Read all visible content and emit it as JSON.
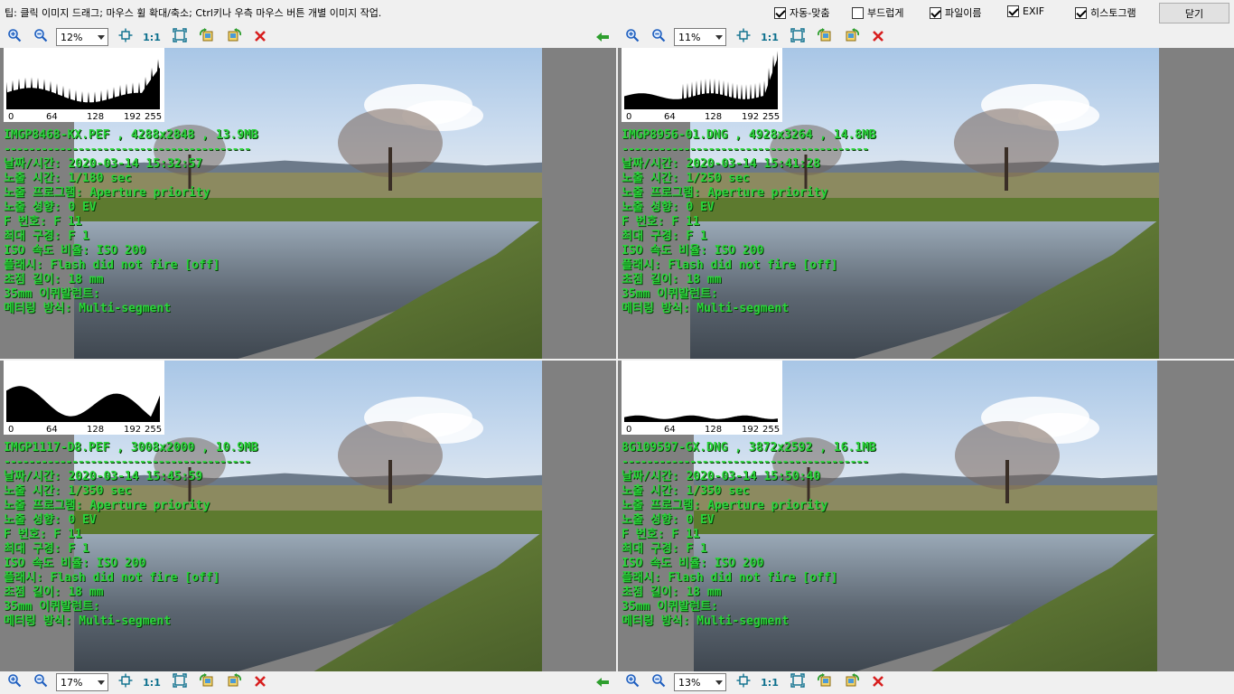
{
  "topbar": {
    "tip": "팁: 클릭 이미지 드래그; 마우스 휠 확대/축소; Ctrl키나 우측 마우스 버튼 개별 이미지 작업.",
    "options": [
      {
        "label": "자동-맞춤",
        "checked": true
      },
      {
        "label": "부드럽게",
        "checked": false
      },
      {
        "label": "파일이름",
        "checked": true
      },
      {
        "label": "EXIF",
        "checked": true
      },
      {
        "label": "히스토그램",
        "checked": true
      }
    ],
    "close_label": "닫기"
  },
  "toolbar_labels": {
    "one_to_one": "1:1"
  },
  "histogram_ticks": [
    "0",
    "64",
    "128",
    "192",
    "255"
  ],
  "panes": [
    {
      "zoom": "12%",
      "filename_line": "IMGP8468-KX.PEF  ,  4288x2848  ,  13.9MB",
      "separator": "----------------------------------------",
      "exif": [
        "날짜/시간: 2020-03-14 15:32:57",
        "노출 시간: 1/180 sec",
        "노출 프로그램: Aperture priority",
        "노출 성향: 0 EV",
        "F 번호: F 11",
        "최대 구경: F 1",
        "ISO 속도 비율: ISO 200",
        "플래시: Flash did not fire [off]",
        "초점 길이: 18 mm",
        "35mm 이퀴발런트:",
        "메터링 방식: Multi-segment"
      ],
      "has_arrow": true
    },
    {
      "zoom": "11%",
      "filename_line": "IMGP8956-01.DNG  ,  4928x3264  ,  14.8MB",
      "separator": "----------------------------------------",
      "exif": [
        "날짜/시간: 2020-03-14 15:41:28",
        "노출 시간: 1/250 sec",
        "노출 프로그램: Aperture priority",
        "노출 성향: 0 EV",
        "F 번호: F 11",
        "최대 구경: F 1",
        "ISO 속도 비율: ISO 200",
        "플래시: Flash did not fire [off]",
        "초점 길이: 18 mm",
        "35mm 이퀴발런트:",
        "메터링 방식: Multi-segment"
      ],
      "has_arrow": false
    },
    {
      "zoom": "17%",
      "filename_line": "IMGP1117-D8.PEF  ,  3008x2000  ,  10.9MB",
      "separator": "----------------------------------------",
      "exif": [
        "날짜/시간: 2020-03-14 15:45:59",
        "노출 시간: 1/350 sec",
        "노출 프로그램: Aperture priority",
        "노출 성향: 0 EV",
        "F 번호: F 11",
        "최대 구경: F 1",
        "ISO 속도 비율: ISO 200",
        "플래시: Flash did not fire [off]",
        "초점 길이: 18 mm",
        "35mm 이퀴발런트:",
        "메터링 방식: Multi-segment"
      ],
      "has_arrow": true
    },
    {
      "zoom": "13%",
      "filename_line": "8G109597-GX.DNG  ,  3872x2592  ,  16.1MB",
      "separator": "----------------------------------------",
      "exif": [
        "날짜/시간: 2020-03-14 15:50:40",
        "노출 시간: 1/350 sec",
        "노출 프로그램: Aperture priority",
        "노출 성향: 0 EV",
        "F 번호: F 11",
        "최대 구경: F 1",
        "ISO 속도 비율: ISO 200",
        "플래시: Flash did not fire [off]",
        "초점 길이: 18 mm",
        "35mm 이퀴발런트:",
        "메터링 방식: Multi-segment"
      ],
      "has_arrow": false
    }
  ],
  "colors": {
    "exif_text": "#2ad53a",
    "zoom_icon": "#1f5fbf",
    "delete_icon": "#d81e1e",
    "arrow_icon": "#2e9e2e"
  }
}
